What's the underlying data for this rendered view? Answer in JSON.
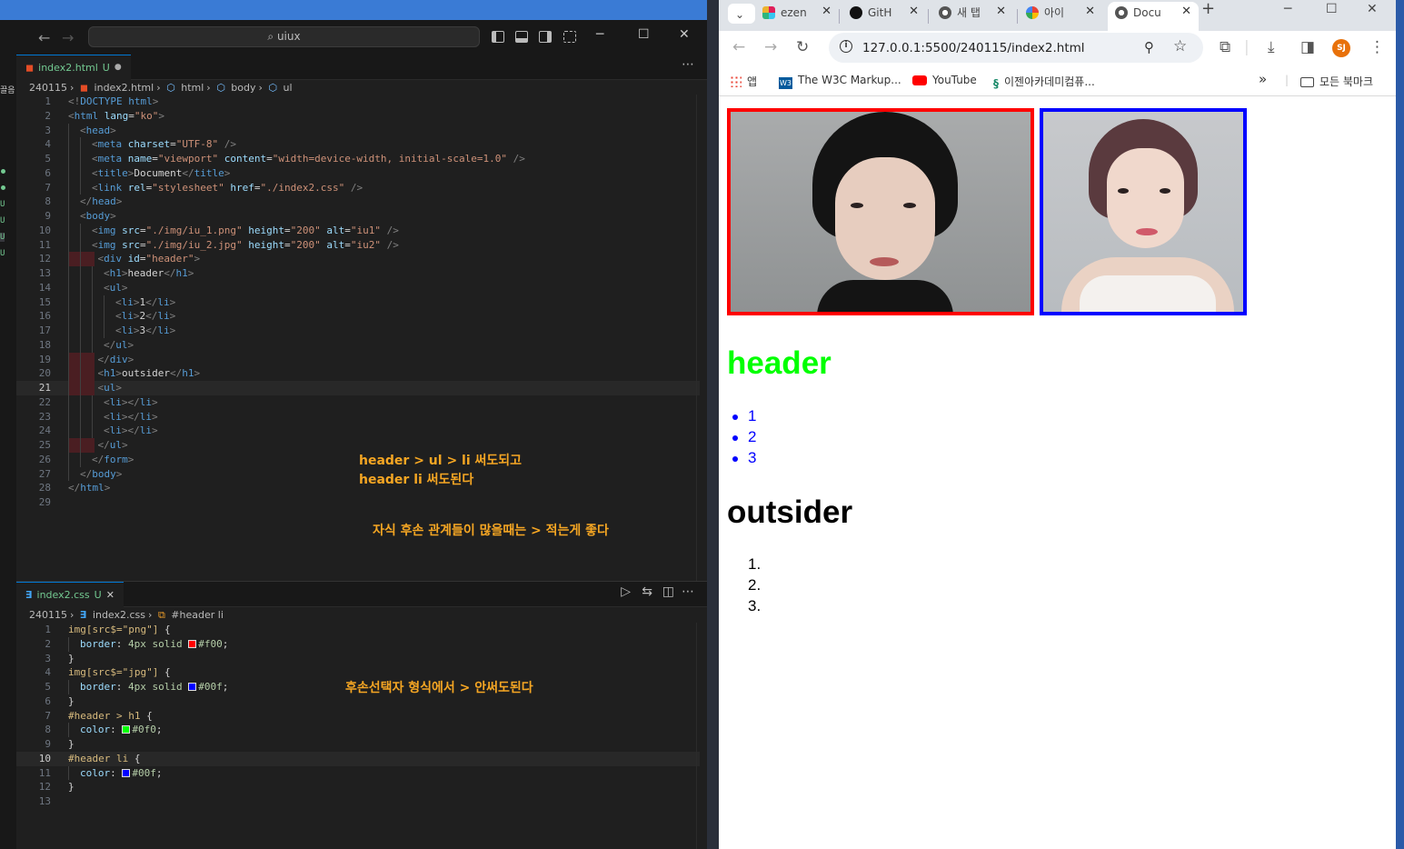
{
  "vscode": {
    "search_text": "uiux",
    "html_tab": {
      "name": "index2.html",
      "status": "U"
    },
    "html_breadcrumb": [
      "240115",
      "index2.html",
      "html",
      "body",
      "ul"
    ],
    "html_lines": [
      "<!DOCTYPE html>",
      "<html lang=\"ko\">",
      "<head>",
      "<meta charset=\"UTF-8\" />",
      "<meta name=\"viewport\" content=\"width=device-width, initial-scale=1.0\" />",
      "<title>Document</title>",
      "<link rel=\"stylesheet\" href=\"./index2.css\" />",
      "</head>",
      "<body>",
      "<img src=\"./img/iu_1.png\" height=\"200\" alt=\"iu1\" />",
      "<img src=\"./img/iu_2.jpg\" height=\"200\" alt=\"iu2\" />",
      "<div id=\"header\">",
      "<h1>header</h1>",
      "<ul>",
      "<li>1</li>",
      "<li>2</li>",
      "<li>3</li>",
      "</ul>",
      "</div>",
      "<h1>outsider</h1>",
      "<ul>",
      "<li></li>",
      "<li></li>",
      "<li></li>",
      "</ul>",
      "</form>",
      "</body>",
      "</html>",
      ""
    ],
    "html_notes": [
      "header > ul > li 써도되고",
      "header li 써도된다",
      "자식 후손 관계들이 많을때는 > 적는게 좋다"
    ],
    "css_tab": {
      "name": "index2.css",
      "status": "U"
    },
    "css_breadcrumb": [
      "240115",
      "index2.css",
      "#header li"
    ],
    "css_lines": [
      "img[src$=\"png\"] {",
      "border: 4px solid #f00;",
      "}",
      "img[src$=\"jpg\"] {",
      "border: 4px solid #00f;",
      "}",
      "#header > h1 {",
      "color: #0f0;",
      "}",
      "#header li {",
      "color: #00f;",
      "}",
      ""
    ],
    "css_note": "후손선택자 형식에서 > 안써도된다",
    "activity_marks": [
      "끌음",
      "U",
      "U",
      "U",
      "U"
    ]
  },
  "chrome": {
    "tabs": [
      "ezen",
      "GitH",
      "새 탭",
      "아이",
      "Docu"
    ],
    "url": "127.0.0.1:5500/240115/index2.html",
    "avatar_initials": "SJ",
    "bookmarks": [
      "앱",
      "The W3C Markup...",
      "YouTube",
      "이젠아카데미컴퓨..."
    ],
    "all_bookmarks": "모든 북마크",
    "page": {
      "header_title": "header",
      "header_items": [
        "1",
        "2",
        "3"
      ],
      "outsider_title": "outsider",
      "outsider_markers": [
        "1.",
        "2.",
        "3."
      ],
      "img1_alt": "iu1",
      "img2_alt": "iu2"
    }
  },
  "colors": {
    "red_border": "#f00",
    "blue_border": "#00f",
    "green_heading": "#0f0",
    "blue_list": "#00f"
  }
}
